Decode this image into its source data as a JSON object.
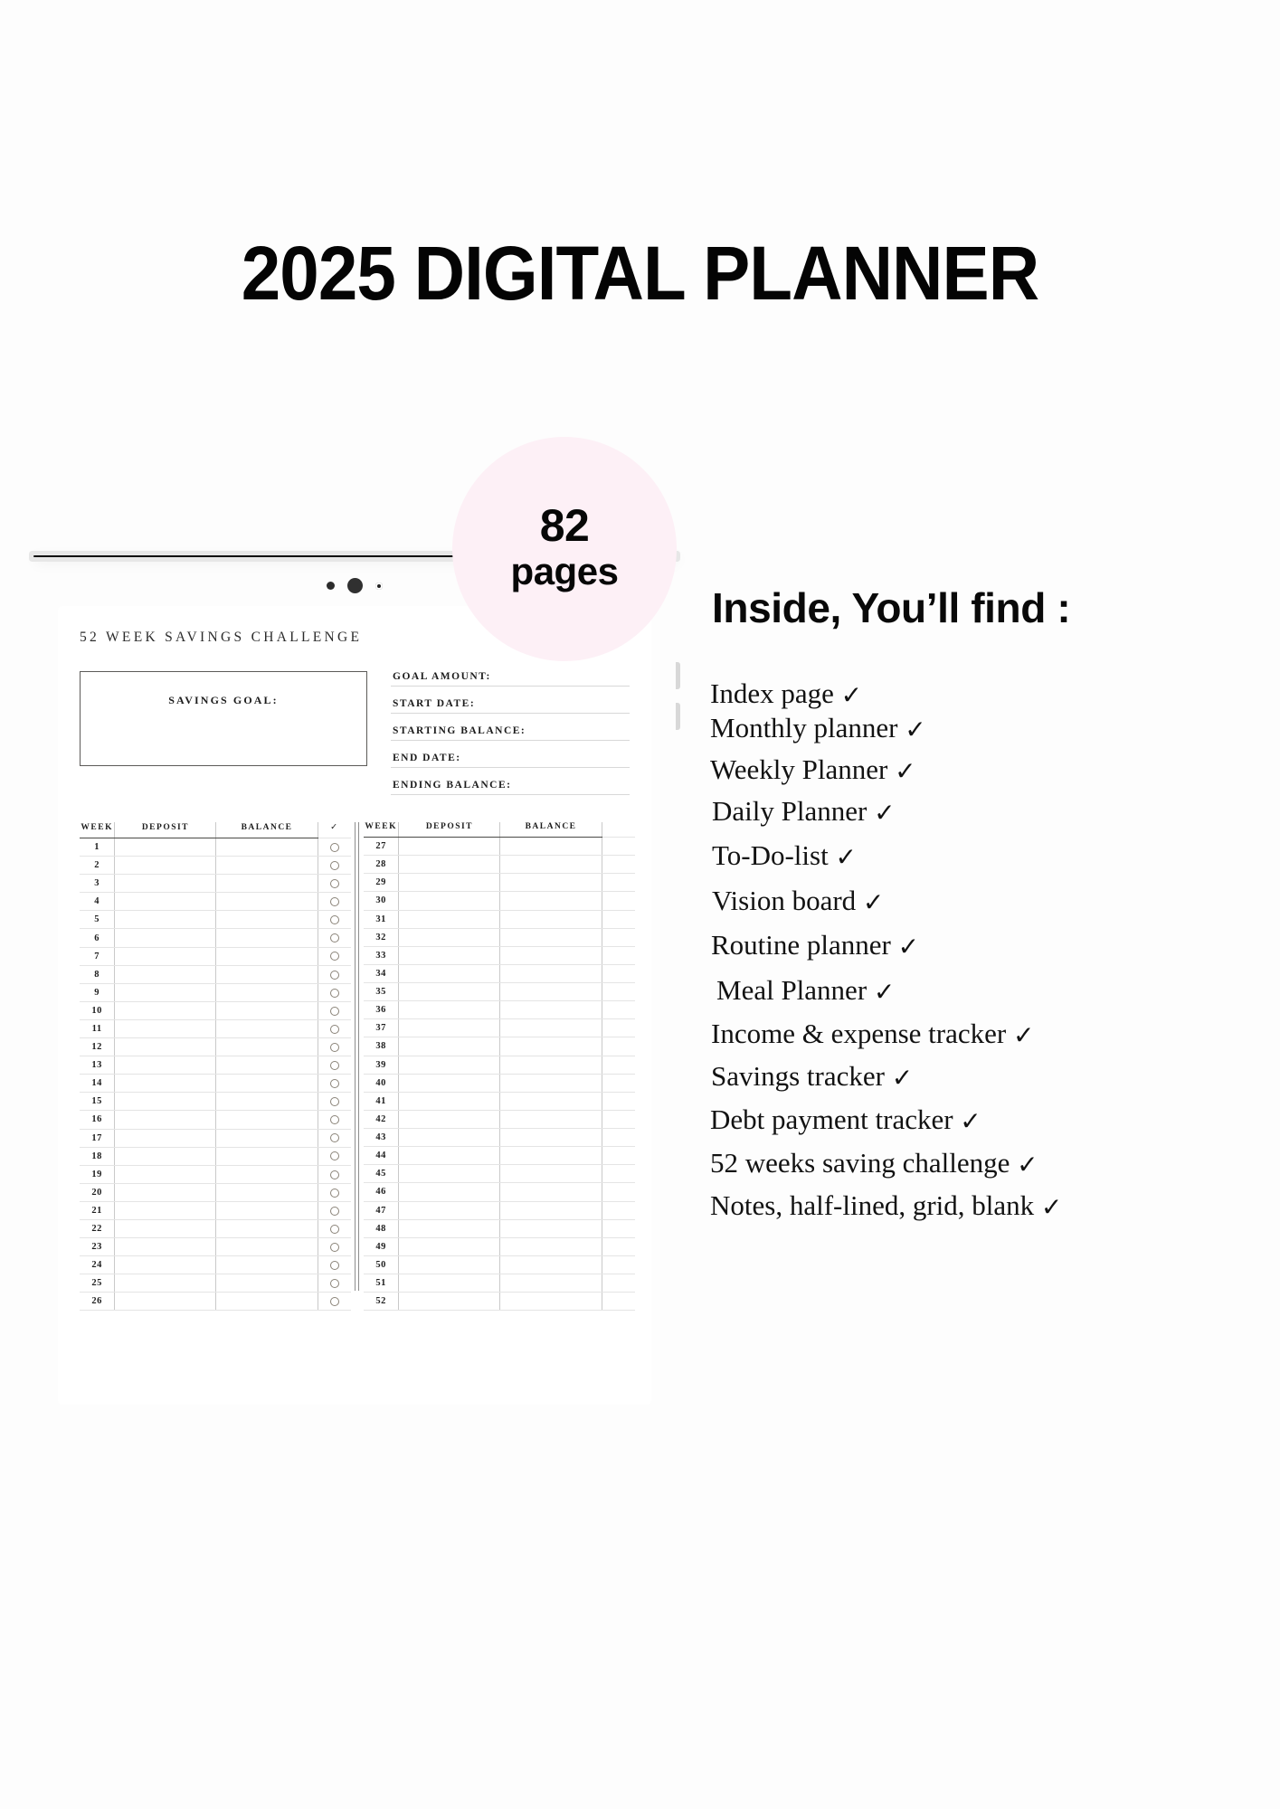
{
  "title": "2025 DIGITAL PLANNER",
  "badge": {
    "count": "82",
    "label": "pages"
  },
  "colors": {
    "badge_background": "#fdf0f6",
    "text": "#0a0a0a",
    "tablet_bezel": "#0a0a0a",
    "table_rule": "#e4e4e4"
  },
  "tablet": {
    "page": {
      "title": "52 WEEK SAVINGS CHALLENGE",
      "goal_box_label": "SAVINGS GOAL:",
      "fields": [
        "GOAL AMOUNT:",
        "START DATE:",
        "STARTING BALANCE:",
        "END DATE:",
        "ENDING BALANCE:"
      ],
      "table_left": {
        "headers": [
          "WEEK",
          "DEPOSIT",
          "BALANCE",
          "✓"
        ],
        "weeks": [
          "1",
          "2",
          "3",
          "4",
          "5",
          "6",
          "7",
          "8",
          "9",
          "10",
          "11",
          "12",
          "13",
          "14",
          "15",
          "16",
          "17",
          "18",
          "19",
          "20",
          "21",
          "22",
          "23",
          "24",
          "25",
          "26"
        ]
      },
      "table_right": {
        "headers": [
          "WEEK",
          "DEPOSIT",
          "BALANCE"
        ],
        "weeks": [
          "27",
          "28",
          "29",
          "30",
          "31",
          "32",
          "33",
          "34",
          "35",
          "36",
          "37",
          "38",
          "39",
          "40",
          "41",
          "42",
          "43",
          "44",
          "45",
          "46",
          "47",
          "48",
          "49",
          "50",
          "51",
          "52"
        ]
      }
    }
  },
  "inside": {
    "heading": "Inside, You’ll find :",
    "check_glyph": "✓",
    "items": [
      "Index page",
      "Monthly planner",
      "Weekly Planner",
      "Daily Planner",
      "To-Do-list",
      "Vision board",
      "Routine planner",
      "Meal Planner",
      "Income & expense tracker",
      "Savings tracker",
      "Debt payment tracker",
      "52 weeks saving challenge",
      "Notes, half-lined, grid, blank"
    ]
  }
}
